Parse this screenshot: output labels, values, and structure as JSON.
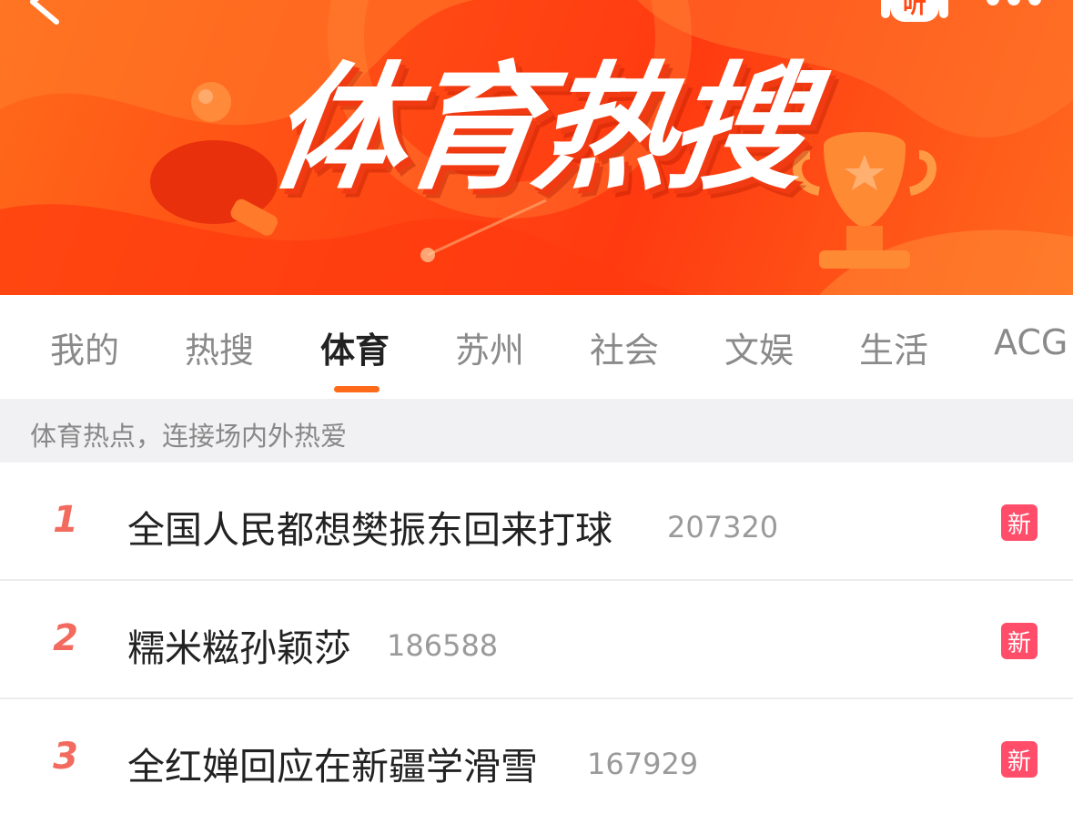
{
  "header": {
    "banner_title": "体育热搜",
    "listen_label": "听"
  },
  "tabs": [
    {
      "label": "我的",
      "active": false
    },
    {
      "label": "热搜",
      "active": false
    },
    {
      "label": "体育",
      "active": true
    },
    {
      "label": "苏州",
      "active": false
    },
    {
      "label": "社会",
      "active": false
    },
    {
      "label": "文娱",
      "active": false
    },
    {
      "label": "生活",
      "active": false
    },
    {
      "label": "ACG",
      "active": false
    }
  ],
  "subtitle": "体育热点，连接场内外热爱",
  "items": [
    {
      "rank": "1",
      "title": "全国人民都想樊振东回来打球",
      "count": "207320",
      "badge": "新"
    },
    {
      "rank": "2",
      "title": "糯米糍孙颖莎",
      "count": "186588",
      "badge": "新"
    },
    {
      "rank": "3",
      "title": "全红婵回应在新疆学滑雪",
      "count": "167929",
      "badge": "新"
    }
  ],
  "colors": {
    "banner_orange": "#ff4a14",
    "tab_indicator": "#ff6a1a",
    "rank_color": "#f36a5e",
    "badge_new": "#ff4d6a"
  }
}
